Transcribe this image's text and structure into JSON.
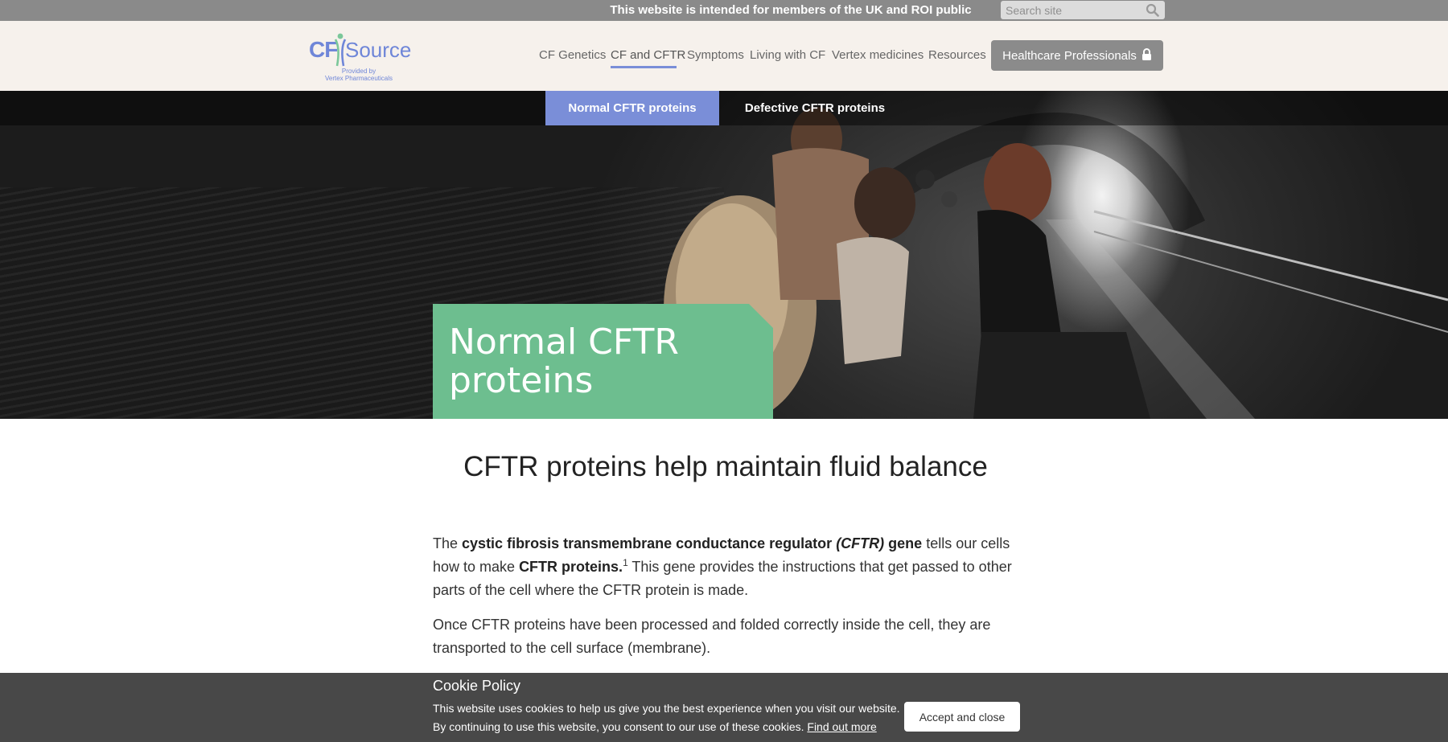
{
  "topbar": {
    "notice": "This website is intended for members of the UK and ROI public",
    "search_placeholder": "Search site"
  },
  "logo": {
    "cf": "CF",
    "source": "Source",
    "tagline_line1": "Provided by",
    "tagline_line2": "Vertex Pharmaceuticals"
  },
  "nav": {
    "items": [
      {
        "label": "CF Genetics"
      },
      {
        "label": "CF and CFTR",
        "active": true
      },
      {
        "label": "Symptoms"
      },
      {
        "label": "Living with CF"
      },
      {
        "label": "Vertex medicines"
      },
      {
        "label": "Resources"
      }
    ],
    "hcp_button": "Healthcare Professionals"
  },
  "subtabs": [
    {
      "label": "Normal CFTR proteins",
      "active": true
    },
    {
      "label": "Defective CFTR proteins"
    }
  ],
  "hero": {
    "title": "Normal CFTR proteins"
  },
  "content": {
    "heading": "CFTR proteins help maintain fluid balance",
    "p1": {
      "t1": "The ",
      "b1": "cystic fibrosis transmembrane conductance regulator ",
      "bi": "(CFTR)",
      "b2": " gene",
      "t2": " tells our cells how to make ",
      "b3": "CFTR proteins.",
      "sup": "1",
      "t3": " This gene provides the instructions that get passed to other parts of the cell where the CFTR protein is made."
    },
    "p2": "Once CFTR proteins have been processed and folded correctly inside the cell, they are transported to the cell surface (membrane)."
  },
  "cookie": {
    "title": "Cookie Policy",
    "line1": "This website uses cookies to help us give you the best experience when you visit our website.",
    "line2": "By continuing to use this website, you consent to our use of these cookies. ",
    "link": "Find out more",
    "accept": "Accept and close"
  },
  "colors": {
    "accent": "#7a8ed8",
    "hero_box": "#6dbe8f",
    "topbar": "#8a8a8a",
    "header_bg": "#f6f1ec"
  },
  "icons": [
    "search-icon",
    "lock-icon"
  ]
}
